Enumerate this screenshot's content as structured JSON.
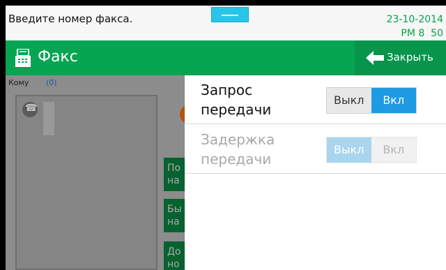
{
  "status_bar": {
    "message": "Введите номер факса.",
    "date": "23-10-2014",
    "time": "PM 8  50"
  },
  "header": {
    "title": "Факс",
    "close_label": "Закрыть",
    "title_icon": "fax-icon",
    "close_icon": "arrow-left-icon"
  },
  "background": {
    "to_label": "Кому",
    "to_count": "(0)",
    "side_buttons": [
      "По\nна",
      "Бы\nна",
      "До\nно"
    ]
  },
  "panel": {
    "rows": [
      {
        "label": "Запрос\nпередачи",
        "off_label": "Выкл",
        "on_label": "Вкл",
        "state": "on",
        "enabled": true
      },
      {
        "label": "Задержка\nпередачи",
        "off_label": "Выкл",
        "on_label": "Вкл",
        "state": "off",
        "enabled": false
      }
    ]
  },
  "colors": {
    "header_green": "#05a552",
    "close_green": "#07944b",
    "toggle_on_blue": "#1e9be2",
    "date_green": "#07a04a"
  }
}
